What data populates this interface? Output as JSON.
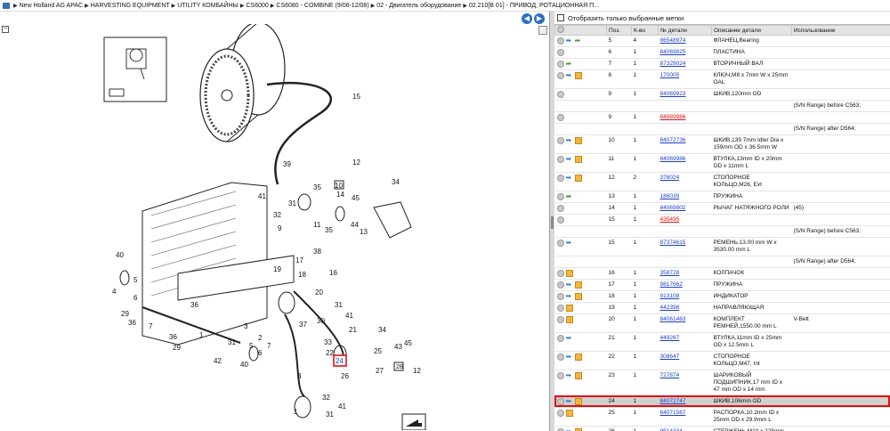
{
  "breadcrumb": [
    "New Holland AG APAC",
    "HARVESTING EQUIPMENT",
    "UTILITY КОМБАЙНЫ",
    "CS6000",
    "CS6080 - COMBINE (9/06-12/08)",
    "02 - Двигатель оборудование",
    "02.210[B 01] - ПРИВОД, РОТАЦИОННАЯ П..."
  ],
  "filter_label": "Отобразить только выбранные метки",
  "columns": [
    "Поз.",
    "К-во",
    "№ детали",
    "Описание детали",
    "Использование"
  ],
  "callouts": [
    "15",
    "39",
    "12",
    "35",
    "10",
    "34",
    "41",
    "31",
    "14",
    "45",
    "32",
    "11",
    "9",
    "35",
    "44",
    "13",
    "40",
    "17",
    "38",
    "19",
    "18",
    "16",
    "5",
    "4",
    "20",
    "6",
    "29",
    "36",
    "7",
    "3",
    "36",
    "37",
    "30",
    "41",
    "29",
    "1",
    "21",
    "2",
    "33",
    "22",
    "34",
    "45",
    "42",
    "25",
    "43",
    "24",
    "26",
    "27",
    "28",
    "12",
    "3",
    "32",
    "1",
    "31",
    "41",
    "31",
    "40",
    "5",
    "6",
    "7"
  ],
  "highlight_callout": "24",
  "rows": [
    {
      "pos": "5",
      "qty": "4",
      "part": "86548974",
      "desc": "ФЛАНЕЦ,Bearing",
      "use": "",
      "icons": [
        "dot",
        "arrow",
        "green"
      ],
      "red": false
    },
    {
      "pos": "6",
      "qty": "1",
      "part": "84069825",
      "desc": "ПЛАСТИНА",
      "use": "",
      "icons": [
        "dot"
      ],
      "red": false
    },
    {
      "pos": "7",
      "qty": "1",
      "part": "87329024",
      "desc": "ВТОРИЧНЫЙ ВАЛ",
      "use": "",
      "icons": [
        "dot",
        "green"
      ],
      "red": false
    },
    {
      "pos": "8",
      "qty": "1",
      "part": "170005",
      "desc": "КЛЮЧ,M8 x 7mm W x 25mm OAL",
      "use": "",
      "icons": [
        "dot",
        "arrow",
        "box"
      ],
      "red": false
    },
    {
      "pos": "9",
      "qty": "1",
      "part": "84069923",
      "desc": "ШКИВ,120mm OD",
      "use": "",
      "icons": [
        "dot"
      ],
      "red": false
    },
    {
      "pos": "",
      "qty": "",
      "part": "",
      "desc": "",
      "use": "(S/N Range) before C563;",
      "icons": [],
      "red": false
    },
    {
      "pos": "9",
      "qty": "1",
      "part": "84989986",
      "desc": "",
      "use": "",
      "icons": [
        "dot"
      ],
      "red": true
    },
    {
      "pos": "",
      "qty": "",
      "part": "",
      "desc": "",
      "use": "(S/N Range) after D564;",
      "icons": [],
      "red": false
    },
    {
      "pos": "10",
      "qty": "1",
      "part": "84072736",
      "desc": "ШКИВ,139.7mm Idler Dia x 159mm OD x 36.5mm W",
      "use": "",
      "icons": [
        "dot",
        "arrow",
        "box"
      ],
      "red": false
    },
    {
      "pos": "11",
      "qty": "1",
      "part": "84069986",
      "desc": "ВТУЛКА,13mm ID x 20mm OD x 11mm L",
      "use": "",
      "icons": [
        "dot",
        "arrow",
        "box"
      ],
      "red": false
    },
    {
      "pos": "12",
      "qty": "2",
      "part": "376024",
      "desc": "СТОПОРНОЕ КОЛЬЦО,M26, Ext",
      "use": "",
      "icons": [
        "dot",
        "arrow",
        "box"
      ],
      "red": false
    },
    {
      "pos": "13",
      "qty": "1",
      "part": "186039",
      "desc": "ПРУЖИНА",
      "use": "",
      "icons": [
        "dot",
        "green"
      ],
      "red": false
    },
    {
      "pos": "14",
      "qty": "1",
      "part": "84069802",
      "desc": "РЫЧАГ НАТЯЖНОГО РОЛИ",
      "use": "(45)",
      "icons": [
        "dot"
      ],
      "red": false
    },
    {
      "pos": "15",
      "qty": "1",
      "part": "435495",
      "desc": "",
      "use": "",
      "icons": [
        "dot"
      ],
      "red": true
    },
    {
      "pos": "",
      "qty": "",
      "part": "",
      "desc": "",
      "use": "(S/N Range) before C563;",
      "icons": [],
      "red": false
    },
    {
      "pos": "15",
      "qty": "1",
      "part": "87374615",
      "desc": "РЕМЕНЬ,13.00 mm W x 3530.00 mm L",
      "use": "",
      "icons": [
        "dot",
        "arrow"
      ],
      "red": false
    },
    {
      "pos": "",
      "qty": "",
      "part": "",
      "desc": "",
      "use": "(S/N Range) after D564;",
      "icons": [],
      "red": false
    },
    {
      "pos": "16",
      "qty": "1",
      "part": "358728",
      "desc": "КОЛПАЧОК",
      "use": "",
      "icons": [
        "dot",
        "box"
      ],
      "red": false
    },
    {
      "pos": "17",
      "qty": "1",
      "part": "9817662",
      "desc": "ПРУЖИНА",
      "use": "",
      "icons": [
        "dot",
        "arrow",
        "box"
      ],
      "red": false
    },
    {
      "pos": "18",
      "qty": "1",
      "part": "913108",
      "desc": "ИНДИКАТОР",
      "use": "",
      "icons": [
        "dot",
        "arrow",
        "box"
      ],
      "red": false
    },
    {
      "pos": "19",
      "qty": "1",
      "part": "442398",
      "desc": "НАПРАВЛЯЮЩАЯ",
      "use": "",
      "icons": [
        "dot",
        "box"
      ],
      "red": false
    },
    {
      "pos": "20",
      "qty": "1",
      "part": "84061463",
      "desc": "КОМПЛЕКТ РЕМНЕЙ,1550.00 mm L",
      "use": "V-Belt",
      "icons": [
        "dot",
        "box"
      ],
      "red": false
    },
    {
      "pos": "21",
      "qty": "1",
      "part": "449267",
      "desc": "ВТУЛКА,11mm ID x 25mm OD x 12.5mm L",
      "use": "",
      "icons": [
        "dot",
        "arrow"
      ],
      "red": false
    },
    {
      "pos": "22",
      "qty": "1",
      "part": "308647",
      "desc": "СТОПОРНОЕ КОЛЬЦО,M47, Int",
      "use": "",
      "icons": [
        "dot",
        "arrow",
        "box"
      ],
      "red": false
    },
    {
      "pos": "23",
      "qty": "1",
      "part": "727874",
      "desc": "ШАРИКОВЫЙ ПОДШИПНИК,17 mm ID x 47 mm OD x 14 mm",
      "use": "",
      "icons": [
        "dot",
        "arrow",
        "box"
      ],
      "red": false
    },
    {
      "pos": "24",
      "qty": "1",
      "part": "84072747",
      "desc": "ШКИВ,106mm OD",
      "use": "",
      "icons": [
        "dot",
        "arrow",
        "box"
      ],
      "red": false,
      "selected": true
    },
    {
      "pos": "25",
      "qty": "1",
      "part": "84071567",
      "desc": "РАСПОРКА,10.2mm ID x 25mm OD x 29.9mm L",
      "use": "",
      "icons": [
        "dot",
        "box"
      ],
      "red": false
    },
    {
      "pos": "26",
      "qty": "1",
      "part": "9514334",
      "desc": "СТЕРЖЕНЬ,M10 x 225mm",
      "use": "",
      "icons": [
        "dot",
        "arrow",
        "box"
      ],
      "red": false
    }
  ]
}
